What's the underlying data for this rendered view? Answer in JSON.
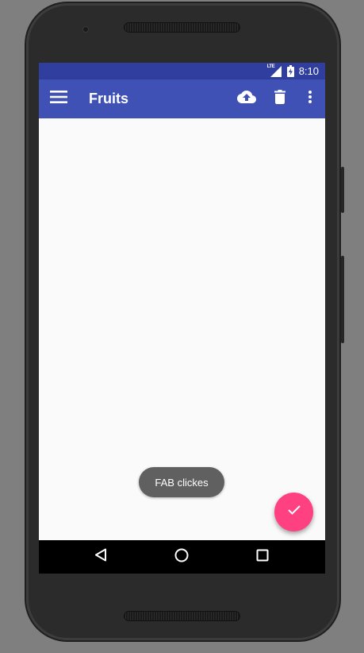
{
  "status_bar": {
    "network_label": "LTE",
    "signal_icon": "signal-icon",
    "battery_icon": "battery-charging-icon",
    "time": "8:10"
  },
  "app_bar": {
    "title": "Fruits",
    "menu_icon": "menu-icon",
    "actions": [
      {
        "name": "upload",
        "icon": "cloud-upload-icon"
      },
      {
        "name": "delete",
        "icon": "delete-icon"
      },
      {
        "name": "overflow",
        "icon": "more-vert-icon"
      }
    ]
  },
  "toast": {
    "text": "FAB clickes"
  },
  "fab": {
    "icon": "check-icon"
  },
  "nav_bar": {
    "buttons": [
      {
        "name": "back",
        "icon": "back-triangle-icon"
      },
      {
        "name": "home",
        "icon": "home-circle-icon"
      },
      {
        "name": "recents",
        "icon": "recents-square-icon"
      }
    ]
  },
  "colors": {
    "primary": "#3f51b5",
    "primary_dark": "#303f9f",
    "accent": "#ff4081",
    "background": "#fafafa",
    "toast_bg": "#606060"
  }
}
